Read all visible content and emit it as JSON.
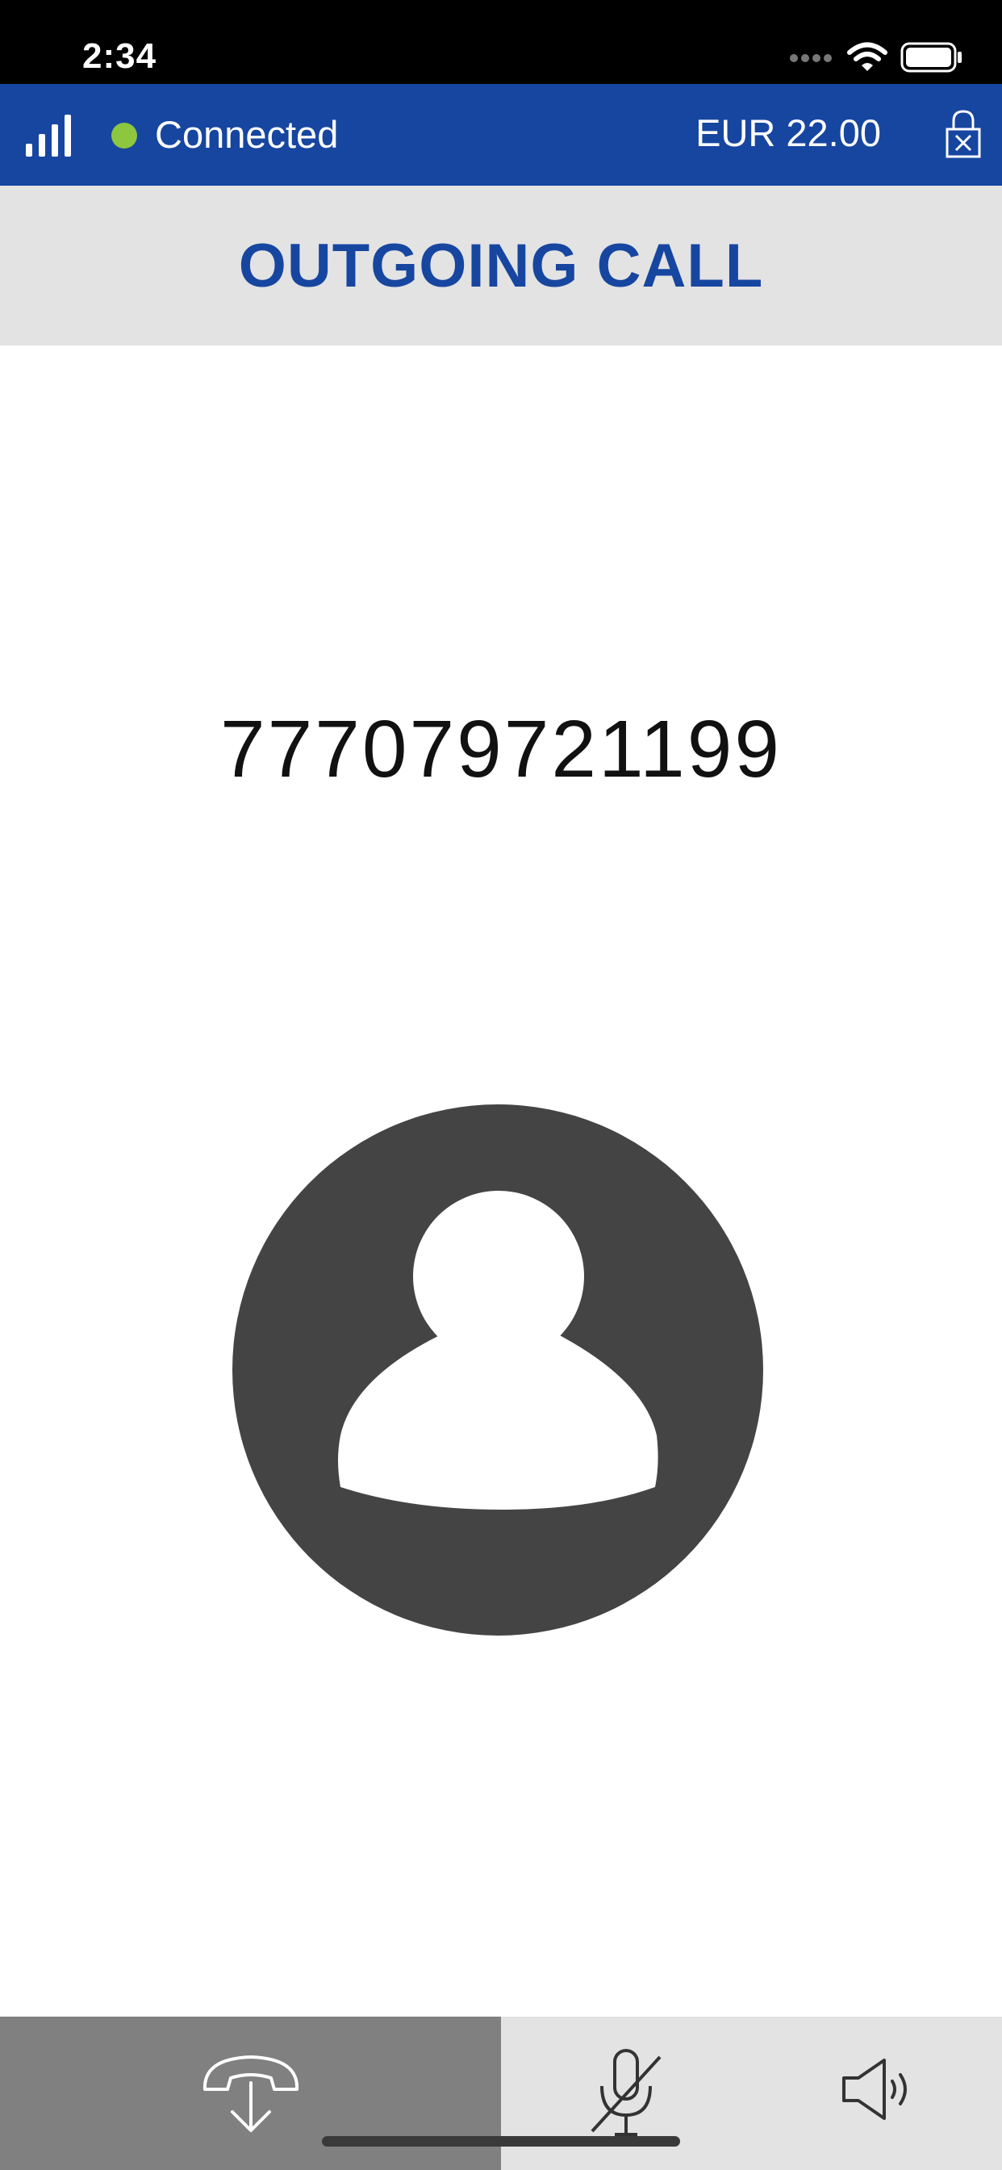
{
  "status_bar": {
    "time": "2:34",
    "icons": [
      "cellular-dots-icon",
      "wifi-icon",
      "battery-icon"
    ]
  },
  "connection_bar": {
    "status": "Connected",
    "status_color": "#8dc63f",
    "balance": "EUR 22.00",
    "background": "#1746a0",
    "icons": [
      "signal-strength-icon",
      "lock-icon"
    ]
  },
  "header": {
    "title": "OUTGOING CALL",
    "title_color": "#1746a0"
  },
  "call": {
    "number": "777079721199",
    "avatar_icon": "user-avatar-icon"
  },
  "controls": [
    {
      "name": "hangup-button",
      "icon": "hangup-icon"
    },
    {
      "name": "mute-button",
      "icon": "mic-off-icon"
    },
    {
      "name": "speaker-button",
      "icon": "speaker-icon"
    }
  ]
}
